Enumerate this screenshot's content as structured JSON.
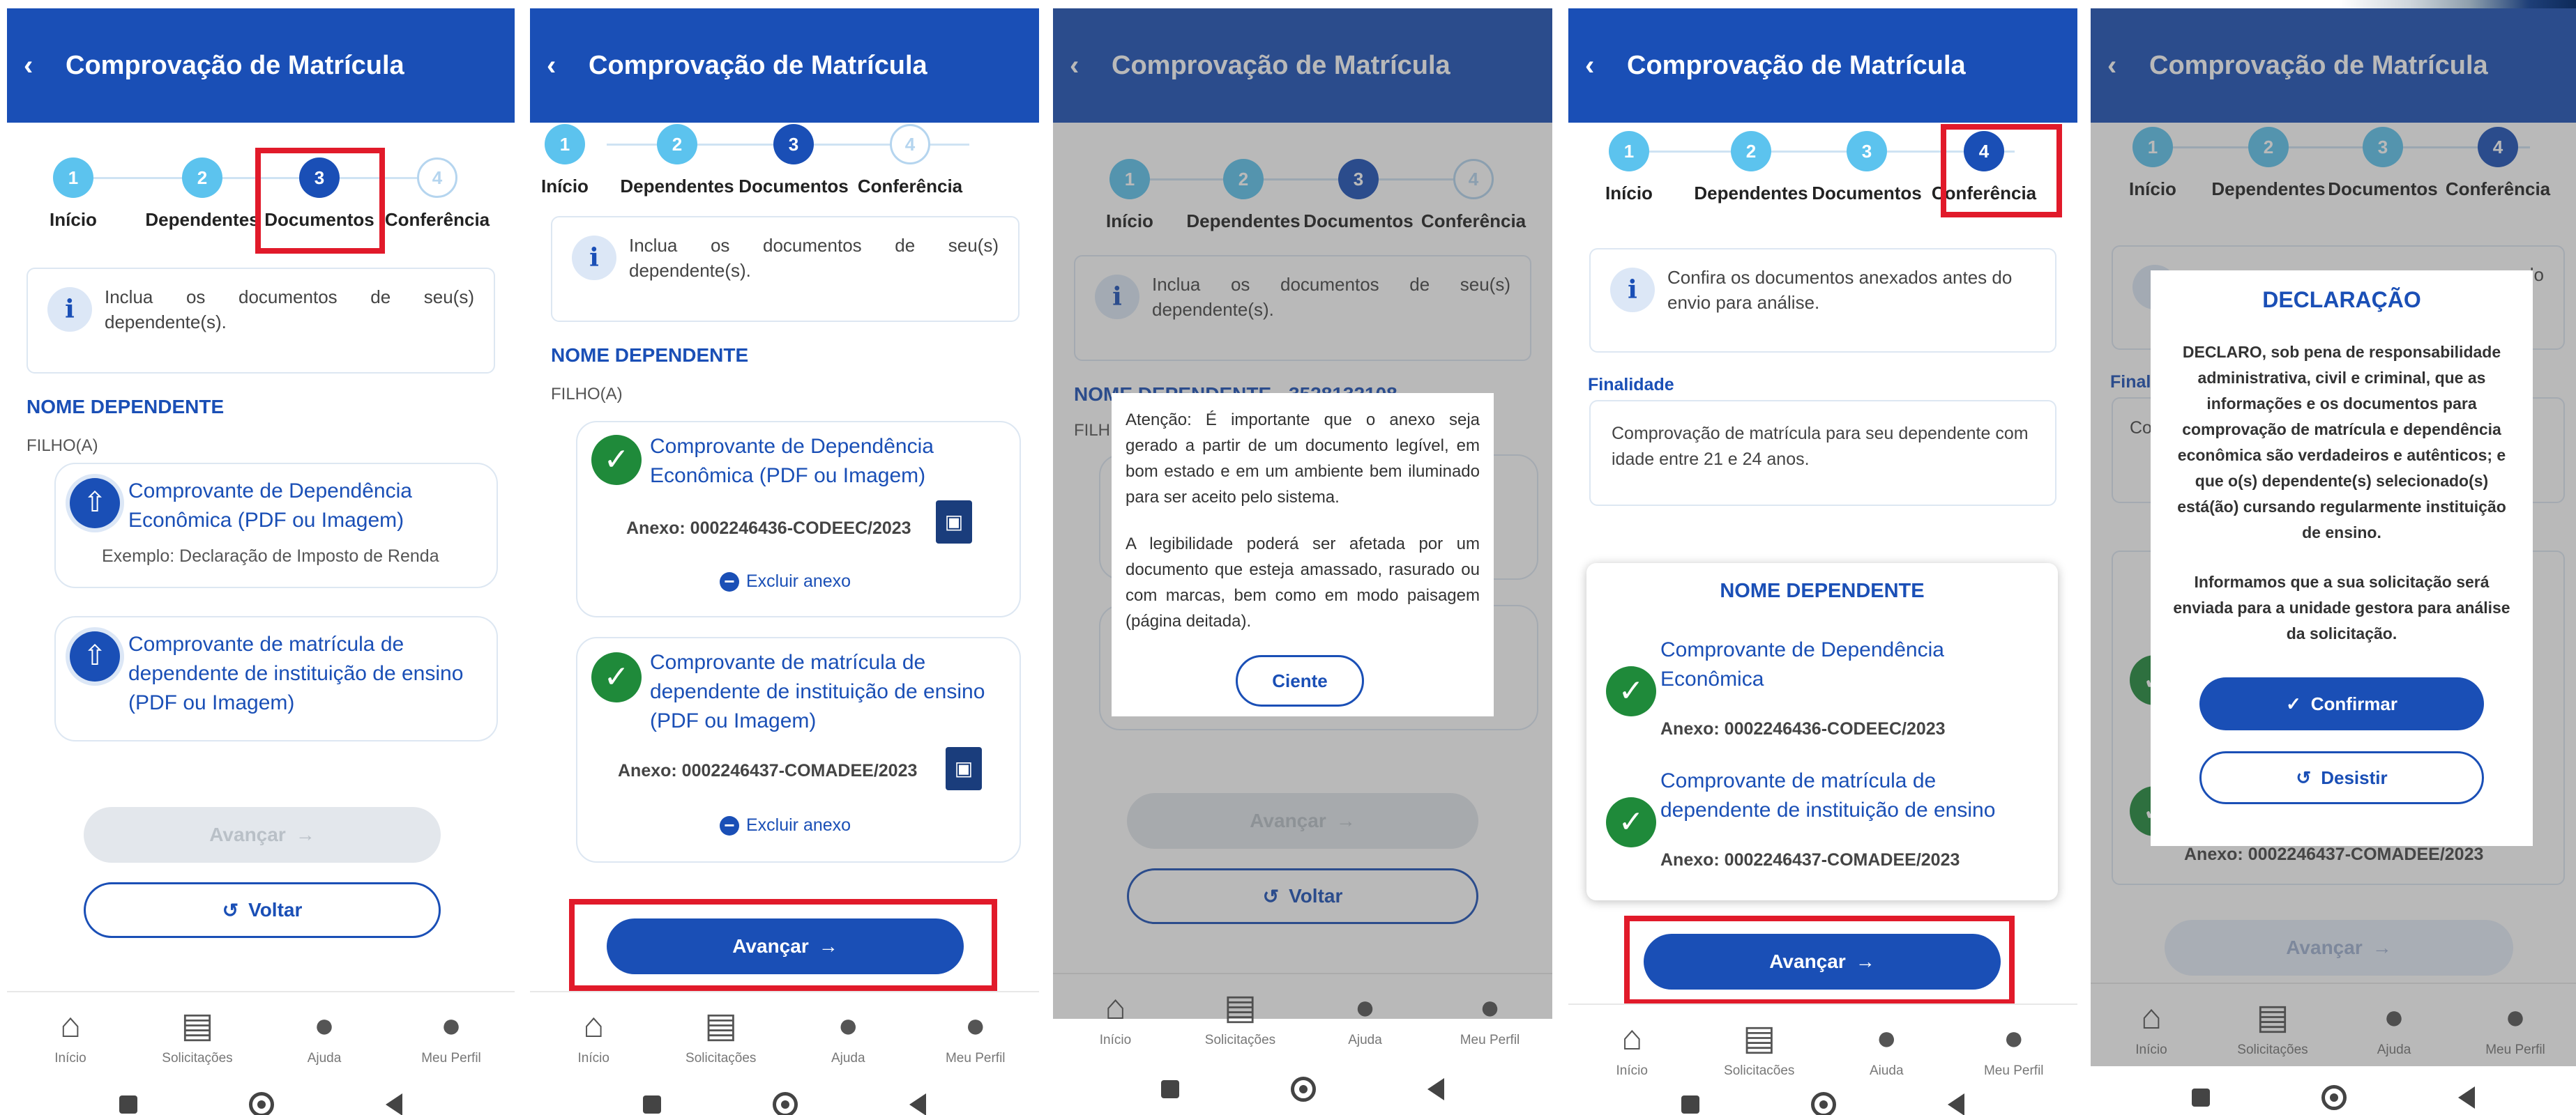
{
  "header": {
    "back": "‹",
    "title": "Comprovação de Matrícula"
  },
  "steps": [
    {
      "num": "1",
      "label": "Início"
    },
    {
      "num": "2",
      "label": "Dependentes"
    },
    {
      "num": "3",
      "label": "Documentos"
    },
    {
      "num": "4",
      "label": "Conferência"
    }
  ],
  "info_docs": "Inclua os documentos de seu(s) dependente(s).",
  "info_conf": "Confira os documentos anexados antes do envio para análise.",
  "dependent": {
    "name": "NOME DEPENDENTE",
    "relation": "FILHO(A)",
    "name_partial": "NOME DEPENDENTE - 3528132108",
    "relation_partial": "FILH"
  },
  "doc1": {
    "title": "Comprovante de Dependência Econômica (PDF ou Imagem)",
    "example": "Exemplo: Declaração de Imposto de Renda",
    "annex": "Anexo: 0002246436-CODEEC/2023",
    "short_title": "Comprovante de Dependência Econômica"
  },
  "doc2": {
    "title": "Comprovante de matrícula de dependente de instituição de ensino (PDF ou Imagem)",
    "annex": "Anexo: 0002246437-COMADEE/2023",
    "short_title": "Comprovante de matrícula de dependente de instituição de ensino"
  },
  "remove_label": "Excluir anexo",
  "buttons": {
    "next": "Avançar",
    "back": "Voltar",
    "confirm": "Confirmar",
    "cancel": "Desistir",
    "ack": "Ciente"
  },
  "attention": {
    "p1": "Atenção: É importante que o anexo seja gerado a partir de um documento legível, em bom estado e em um ambiente bem iluminado para ser aceito pelo sistema.",
    "p2": "A legibilidade poderá ser afetada por um documento que esteja amassado, rasurado ou com marcas, bem como em modo paisagem (página deitada)."
  },
  "finalidade": {
    "label": "Finalidade",
    "text": "Comprovação de matrícula para seu dependente com idade entre 21 e 24 anos."
  },
  "declaration": {
    "title": "DECLARAÇÃO",
    "p1": "DECLARO, sob pena de responsabilidade administrativa, civil e criminal, que as informações e os documentos para comprovação de matrícula e dependência econômica são verdadeiros e autênticos; e que o(s) dependente(s) selecionado(s) está(ão) cursando regularmente instituição de ensino.",
    "p2": "Informamos que a sua solicitação será enviada para a unidade gestora para análise da solicitação.",
    "bg_fin": "Final",
    "bg_co": "Co",
    "bg_do": "do"
  },
  "nav": [
    {
      "label": "Início",
      "icon": "home-icon"
    },
    {
      "label": "Solicitações",
      "icon": "clipboard-icon"
    },
    {
      "label": "Ajuda",
      "icon": "chat-icon"
    },
    {
      "label": "Meu Perfil",
      "icon": "user-icon"
    }
  ],
  "colors": {
    "primary": "#1a4fb6",
    "success": "#1f8a3a",
    "highlight": "#e11a2a"
  }
}
